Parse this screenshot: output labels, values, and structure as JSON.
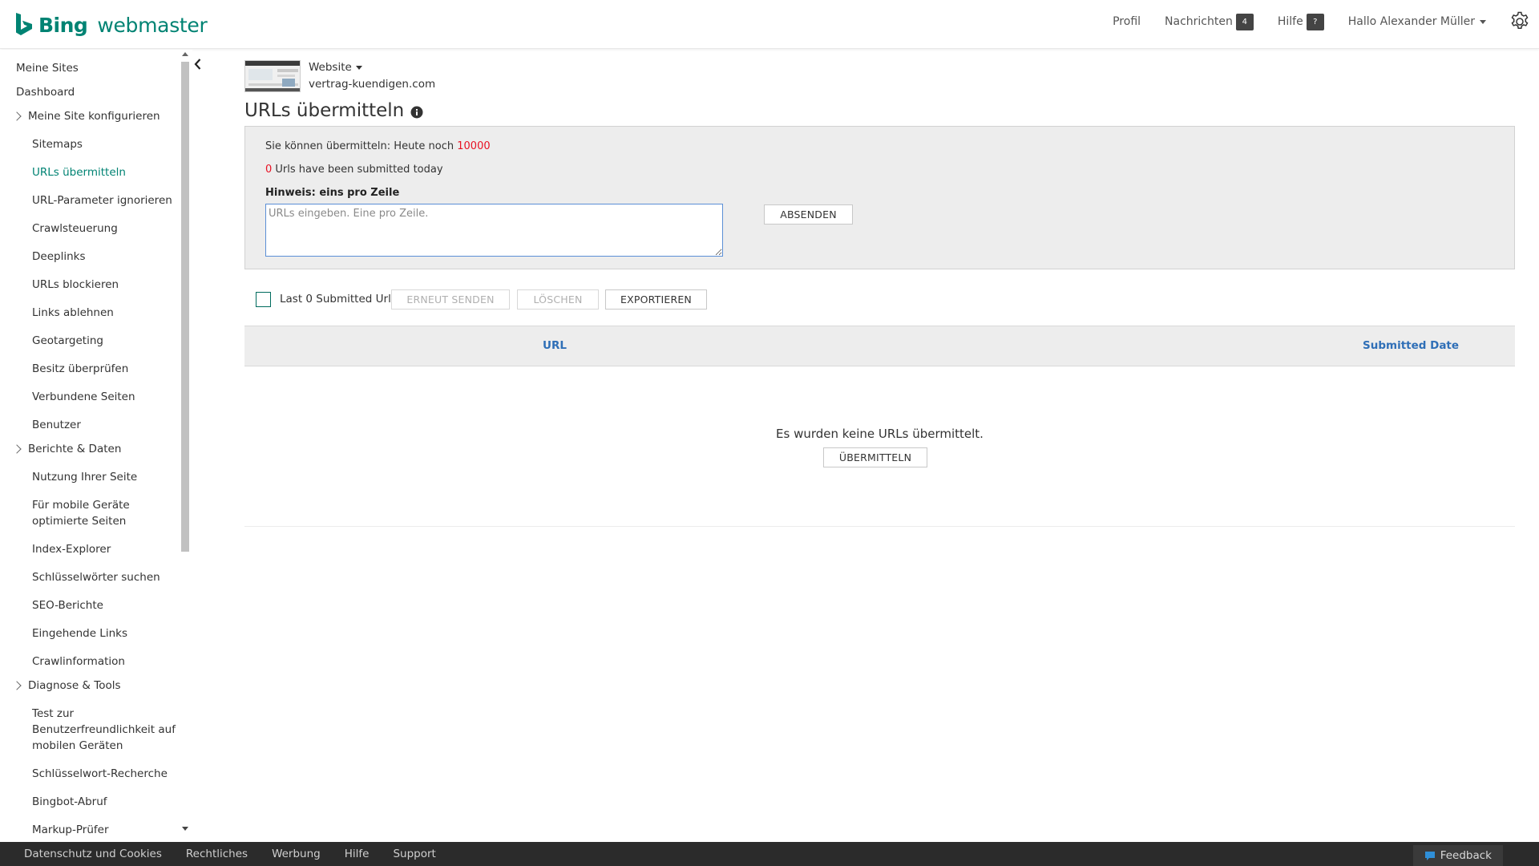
{
  "header": {
    "logo_bing": "Bing",
    "logo_webmaster": "webmaster",
    "nav": {
      "profile": "Profil",
      "messages": "Nachrichten",
      "messages_count": "4",
      "help": "Hilfe",
      "help_badge": "?",
      "user_greeting": "Hallo Alexander Müller"
    }
  },
  "sidebar": {
    "my_sites": "Meine Sites",
    "dashboard": "Dashboard",
    "group_configure": "Meine Site konfigurieren",
    "configure_items": [
      "Sitemaps",
      "URLs übermitteln",
      "URL-Parameter ignorieren",
      "Crawlsteuerung",
      "Deeplinks",
      "URLs blockieren",
      "Links ablehnen",
      "Geotargeting",
      "Besitz überprüfen",
      "Verbundene Seiten",
      "Benutzer"
    ],
    "group_reports": "Berichte & Daten",
    "reports_items": [
      "Nutzung Ihrer Seite",
      "Für mobile Geräte optimierte Seiten",
      "Index-Explorer",
      "Schlüsselwörter suchen",
      "SEO-Berichte",
      "Eingehende Links",
      "Crawlinformation"
    ],
    "group_diagnostics": "Diagnose & Tools",
    "diagnostics_items": [
      "Test zur Benutzerfreundlichkeit auf mobilen Geräten",
      "Schlüsselwort-Recherche",
      "Bingbot-Abruf",
      "Markup-Prüfer"
    ]
  },
  "site": {
    "selector_label": "Website",
    "url": "vertrag-kuendigen.com"
  },
  "page": {
    "title": "URLs übermitteln",
    "quota_prefix": "Sie können übermitteln: Heute noch",
    "quota_value": "10000",
    "submitted_count": "0",
    "submitted_suffix": "Urls have been submitted today",
    "hint": "Hinweis: eins pro Zeile",
    "textarea_placeholder": "URLs eingeben. Eine pro Zeile.",
    "submit_button": "ABSENDEN"
  },
  "toolbar": {
    "last_submitted_label": "Last 0 Submitted Urls",
    "resend_button": "ERNEUT SENDEN",
    "delete_button": "LÖSCHEN",
    "export_button": "EXPORTIEREN"
  },
  "table": {
    "col_url": "URL",
    "col_date": "Submitted Date",
    "empty_message": "Es wurden keine URLs übermittelt.",
    "empty_submit_button": "ÜBERMITTELN"
  },
  "footer": {
    "links": [
      "Datenschutz und Cookies",
      "Rechtliches",
      "Werbung",
      "Hilfe",
      "Support"
    ],
    "feedback": "Feedback"
  },
  "colors": {
    "brand": "#008373",
    "accent_red": "#e81123",
    "column_header_link": "#2f6fb7",
    "footer_bg": "#2b2b2b"
  },
  "icons": {
    "logo": "bing-b-logo",
    "settings": "gear-icon",
    "info": "info-icon",
    "collapse": "chevron-left-icon",
    "feedback": "chat-bubble-icon"
  }
}
